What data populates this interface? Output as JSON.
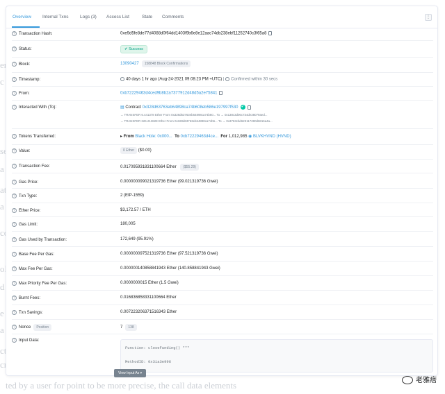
{
  "tabs": [
    {
      "label": "Overview",
      "active": true
    },
    {
      "label": "Internal Txns"
    },
    {
      "label": "Logs (3)"
    },
    {
      "label": "Access List"
    },
    {
      "label": "State"
    },
    {
      "label": "Comments"
    }
  ],
  "menu_glyph": "⋮",
  "help_glyph": "?",
  "rows": {
    "tx_hash": {
      "label": "Transaction Hash:",
      "value": "0xe9d5fe8de77d4088d0f64dd1403f9b6e8e12aac74db238ebf11252740c3f65a8"
    },
    "status": {
      "label": "Status:",
      "value": "Success"
    },
    "block": {
      "label": "Block:",
      "value": "13090427",
      "confirmations": "158848 Block Confirmations"
    },
    "timestamp": {
      "label": "Timestamp:",
      "value": "40 days 1 hr ago (Aug-24-2021 09:08:23 PM +UTC)",
      "confirmed": "Confirmed within 30 secs"
    },
    "from": {
      "label": "From:",
      "value": "0xb72229463d4ced9b8b2a7377912d48d5a2e75841"
    },
    "interacted": {
      "label": "Interacted With (To):",
      "prefix": "Contract",
      "value": "0x328d63763eb64898ca74b608eb586e197997f530"
    },
    "transfers": [
      "→ TRANSFER  6.441378 Ether From 0x328d63763eb64898ca74b60... To → 0x138c3d06c734de38079aed...",
      "→ TRANSFER  326.213828 Ether From 0x328d63763eb64898ca74b6... To → 0x3763cbd623117280d6816a4a..."
    ],
    "tokens": {
      "label": "Tokens Transferred:",
      "from_prefix": "From",
      "from": "Black Hole: 0x000...",
      "to_prefix": "To",
      "to": "0xb72229463d4ce...",
      "for_prefix": "For",
      "amount": "1,012,985",
      "token": "BLVKHVND (HVND)"
    },
    "value": {
      "label": "Value:",
      "value": "0 Ether",
      "usd": "($0.00)"
    },
    "fee": {
      "label": "Transaction Fee:",
      "value": "0.017095931831100664 Ether",
      "usd": "($55.29)"
    },
    "gas_price": {
      "label": "Gas Price:",
      "value": "0.000000099021319736 Ether (99.021319736 Gwei)"
    },
    "txn_type": {
      "label": "Txn Type:",
      "value": "2 (EIP-1559)"
    },
    "ether_price": {
      "label": "Ether Price:",
      "value": "$3,172.57 / ETH"
    },
    "gas_limit": {
      "label": "Gas Limit:",
      "value": "180,005"
    },
    "gas_used": {
      "label": "Gas Used by Transaction:",
      "value": "172,649 (95.91%)"
    },
    "base_fee": {
      "label": "Base Fee Per Gas:",
      "value": "0.000000097521319736 Ether (97.521319736 Gwei)"
    },
    "max_fee": {
      "label": "Max Fee Per Gas:",
      "value": "0.000000140858841943 Ether (140.858841943 Gwei)"
    },
    "max_priority": {
      "label": "Max Priority Fee Per Gas:",
      "value": "0.0000000015 Ether (1.5 Gwei)"
    },
    "burnt": {
      "label": "Burnt Fees:",
      "value": "0.016836858331100664 Ether"
    },
    "savings": {
      "label": "Txn Savings:",
      "value": "0.007223206371516343 Ether"
    },
    "nonce": {
      "label": "Nonce",
      "badge": "Position",
      "value": "7",
      "position": "138"
    },
    "input": {
      "label": "Input Data:",
      "function": "Function: closeFunding() ***",
      "method": "MethodID: 0x31a3e996",
      "button": "View Input As ▾"
    }
  },
  "watermark": "老雅痞",
  "background_text": [
    "ence",
    "c",
    "se",
    "a",
    "at",
    "a",
    "co",
    "ol",
    "d",
    "e",
    "a",
    "ctx",
    "cri",
    "ted by a user for point to be more precise, the call data elements"
  ],
  "colors": {
    "link": "#3498db",
    "success": "#00a186",
    "muted": "#77838f"
  }
}
